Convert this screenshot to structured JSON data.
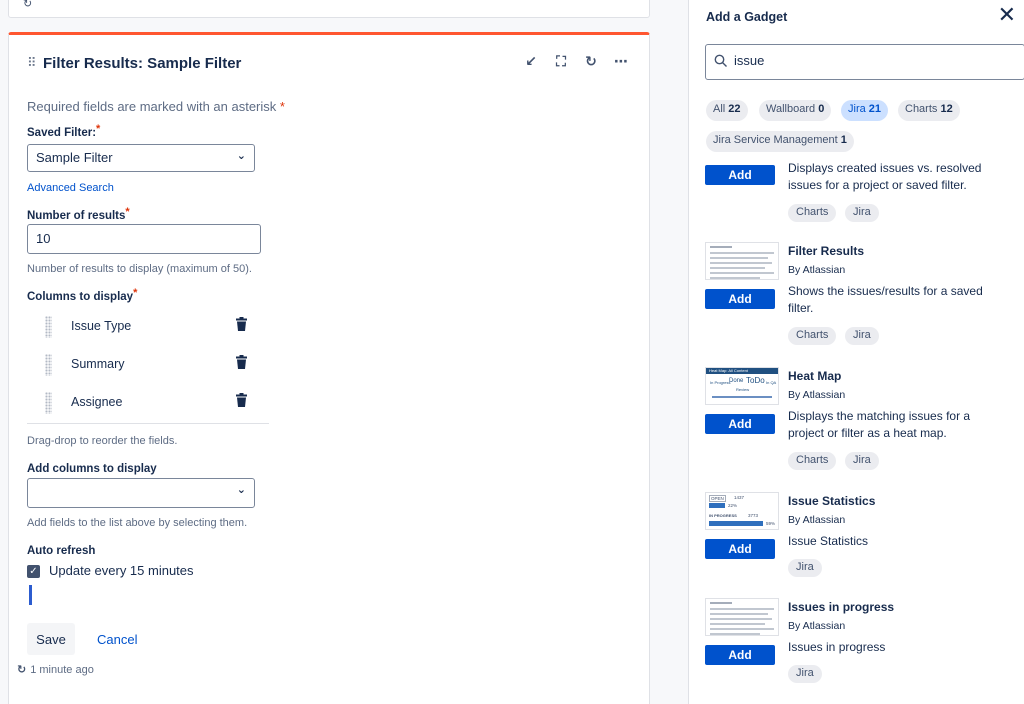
{
  "dashboard": {
    "gadget_title": "Filter Results: Sample Filter",
    "required_note": "Required fields are marked with an asterisk",
    "saved_filter_label": "Saved Filter:",
    "saved_filter_value": "Sample Filter",
    "advanced_search": "Advanced Search",
    "num_results_label": "Number of results",
    "num_results_value": "10",
    "num_results_help": "Number of results to display (maximum of 50).",
    "columns_label": "Columns to display",
    "columns": [
      "Issue Type",
      "Summary",
      "Assignee"
    ],
    "drag_help": "Drag-drop to reorder the fields.",
    "add_columns_label": "Add columns to display",
    "add_columns_value": "",
    "add_columns_help": "Add fields to the list above by selecting them.",
    "auto_refresh_label": "Auto refresh",
    "auto_refresh_option": "Update every 15 minutes",
    "auto_refresh_checked": true,
    "save_label": "Save",
    "cancel_label": "Cancel",
    "last_updated": "1 minute ago",
    "accent_color": "#ff5630"
  },
  "panel": {
    "title": "Add a Gadget",
    "search_value": "issue",
    "filters": [
      {
        "label": "All",
        "count": "22"
      },
      {
        "label": "Wallboard",
        "count": "0"
      },
      {
        "label": "Jira",
        "count": "21"
      },
      {
        "label": "Charts",
        "count": "12"
      },
      {
        "label": "Jira Service Management",
        "count": "1"
      }
    ],
    "active_filter": "Jira",
    "gadgets": [
      {
        "title": "",
        "by": "",
        "desc": "Displays created issues vs. resolved issues for a project or saved filter.",
        "tags": [
          "Charts",
          "Jira"
        ],
        "add_label": "Add"
      },
      {
        "title": "Filter Results",
        "by": "By Atlassian",
        "desc": "Shows the issues/results for a saved filter.",
        "tags": [
          "Charts",
          "Jira"
        ],
        "add_label": "Add"
      },
      {
        "title": "Heat Map",
        "by": "By Atlassian",
        "desc": "Displays the matching issues for a project or filter as a heat map.",
        "tags": [
          "Charts",
          "Jira"
        ],
        "add_label": "Add",
        "thumb_text": [
          "Heat Map: All Content",
          "In Progress",
          "Done",
          "ToDo",
          "In QA",
          "Review"
        ]
      },
      {
        "title": "Issue Statistics",
        "by": "By Atlassian",
        "desc": "Issue Statistics",
        "tags": [
          "Jira"
        ],
        "add_label": "Add",
        "thumb_text": [
          "OPEN",
          "1437",
          "22%",
          "IN PROGRESS",
          "3773",
          "59%"
        ]
      },
      {
        "title": "Issues in progress",
        "by": "By Atlassian",
        "desc": "Issues in progress",
        "tags": [
          "Jira"
        ],
        "add_label": "Add"
      }
    ],
    "brand_color": "#0052cc"
  }
}
